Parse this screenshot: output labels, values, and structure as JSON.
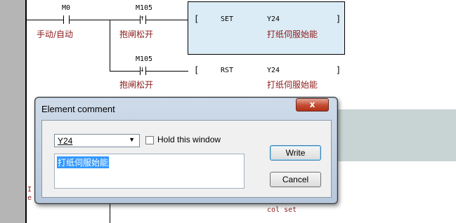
{
  "ladder": {
    "row1": {
      "contact1_device": "M0",
      "contact1_comment": "手动/自动",
      "contact2_device": "M105",
      "contact2_comment": "抱闸松开",
      "instr_open": "[",
      "instr_op": "SET",
      "instr_device": "Y24",
      "instr_close": "]",
      "instr_comment": "打纸伺服始能"
    },
    "row2": {
      "contact_device": "M105",
      "contact_comment": "抱闸松开",
      "instr_open": "[",
      "instr_op": "RST",
      "instr_device": "Y24",
      "instr_close": "]",
      "instr_comment": "打纸伺服始能"
    },
    "partial_bottom": "col set",
    "partial_left_a": "I",
    "partial_left_b": "e"
  },
  "dialog": {
    "title": "Element comment",
    "close_label": "x",
    "device_select": "Y24",
    "hold_label": "Hold this window",
    "hold_checked": false,
    "comment_text": "打纸伺服始能",
    "write_label": "Write",
    "cancel_label": "Cancel"
  },
  "colors": {
    "comment_text": "#8b1a1a",
    "set_box_fill": "#dcecf6",
    "selection": "#3399ff"
  }
}
